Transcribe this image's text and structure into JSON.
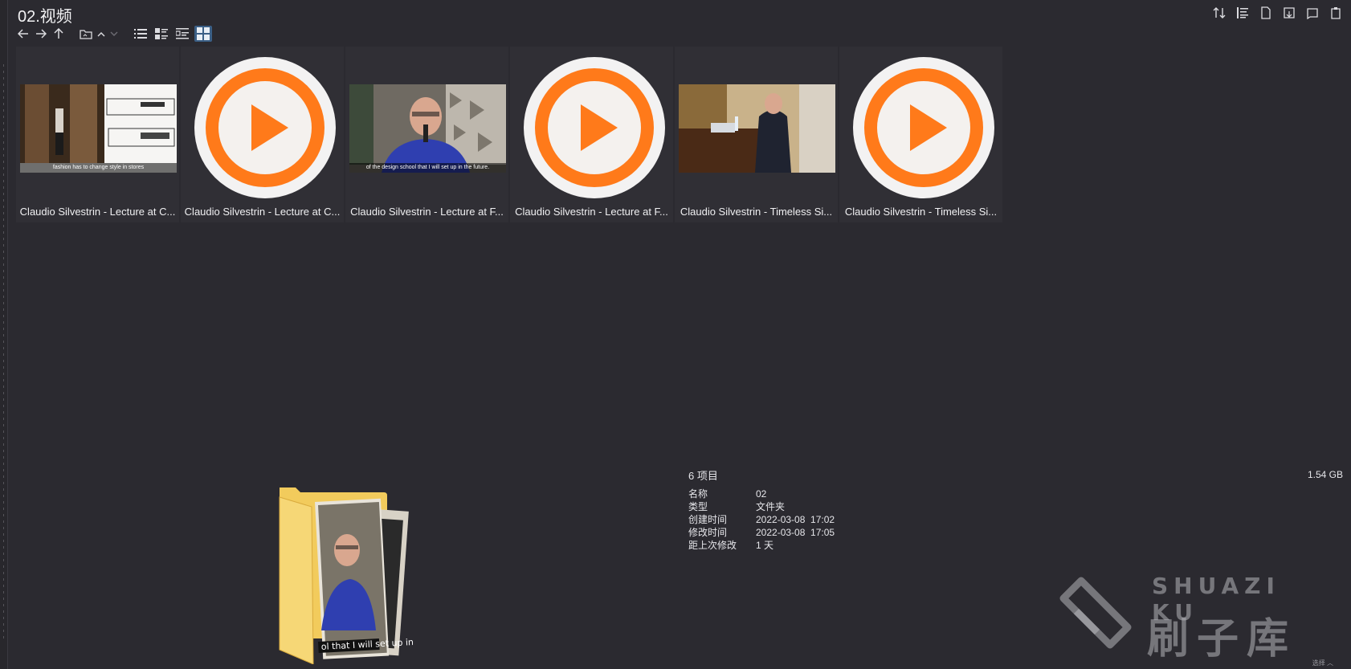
{
  "window": {
    "title": "02.视频"
  },
  "files": [
    {
      "name": "Claudio Silvestrin - Lecture at C...",
      "kind": "thumb",
      "subtitle": "fashion has to change style in stores"
    },
    {
      "name": "Claudio Silvestrin - Lecture at C...",
      "kind": "player"
    },
    {
      "name": "Claudio Silvestrin - Lecture at F...",
      "kind": "thumb",
      "subtitle": "of the design school that I will set up in the future."
    },
    {
      "name": "Claudio Silvestrin - Lecture at F...",
      "kind": "player"
    },
    {
      "name": "Claudio Silvestrin - Timeless Si...",
      "kind": "thumb"
    },
    {
      "name": "Claudio Silvestrin - Timeless Si...",
      "kind": "player"
    }
  ],
  "folder_info": {
    "count": "6 项目",
    "size": "1.54 GB",
    "rows": [
      {
        "key": "名称",
        "value": "02"
      },
      {
        "key": "类型",
        "value": "文件夹"
      },
      {
        "key": "创建时间",
        "value": "2022-03-08  17:02"
      },
      {
        "key": "修改时间",
        "value": "2022-03-08  17:05"
      },
      {
        "key": "距上次修改",
        "value": "1 天"
      }
    ]
  },
  "folder_preview": {
    "subtitle": "ol that I will set up in th"
  },
  "watermark": {
    "latin": "SHUAZI KU",
    "cjk": "刷子库"
  },
  "corner_text": "选择 ︿",
  "colors": {
    "background": "#2b2a30",
    "accent": "#3b5f86",
    "player_orange": "#ff7a1a"
  }
}
